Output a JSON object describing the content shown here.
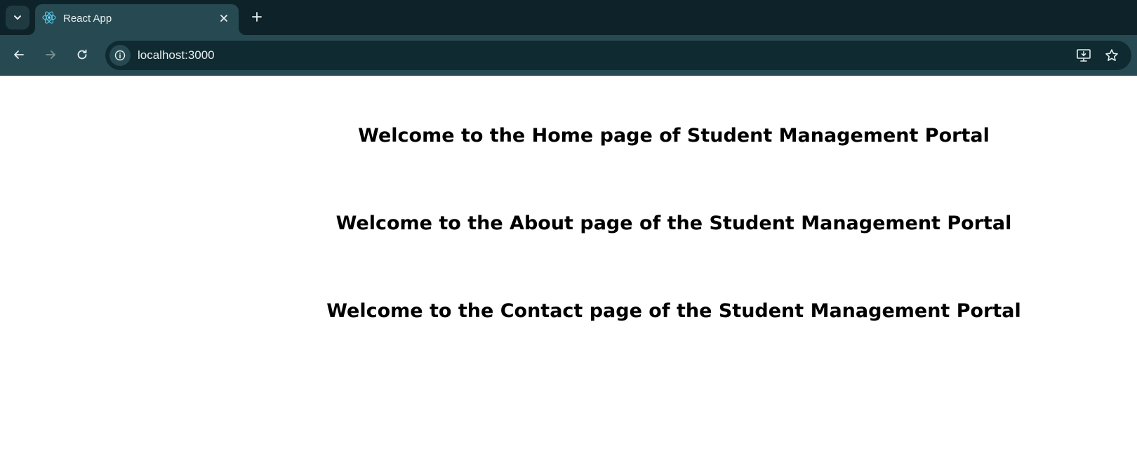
{
  "browser": {
    "tab": {
      "title": "React App",
      "favicon": "react-logo-icon"
    },
    "address_bar": {
      "url": "localhost:3000"
    },
    "icons": {
      "tab_search": "chevron-down-icon",
      "close": "close-icon",
      "new_tab": "plus-icon",
      "back": "back-arrow-icon",
      "forward": "forward-arrow-icon",
      "reload": "reload-icon",
      "site_info": "info-icon",
      "install": "install-app-icon",
      "bookmark": "star-icon"
    },
    "colors": {
      "tabstrip_bg": "#0e2329",
      "toolbar_bg": "#274a52",
      "omnibox_bg": "#0f2a30",
      "react_accent": "#61dafb"
    }
  },
  "page": {
    "headings": {
      "home": "Welcome to the Home page of Student Management Portal",
      "about": "Welcome to the About page of the Student Management Portal",
      "contact": "Welcome to the Contact page of the Student Management Portal"
    }
  }
}
